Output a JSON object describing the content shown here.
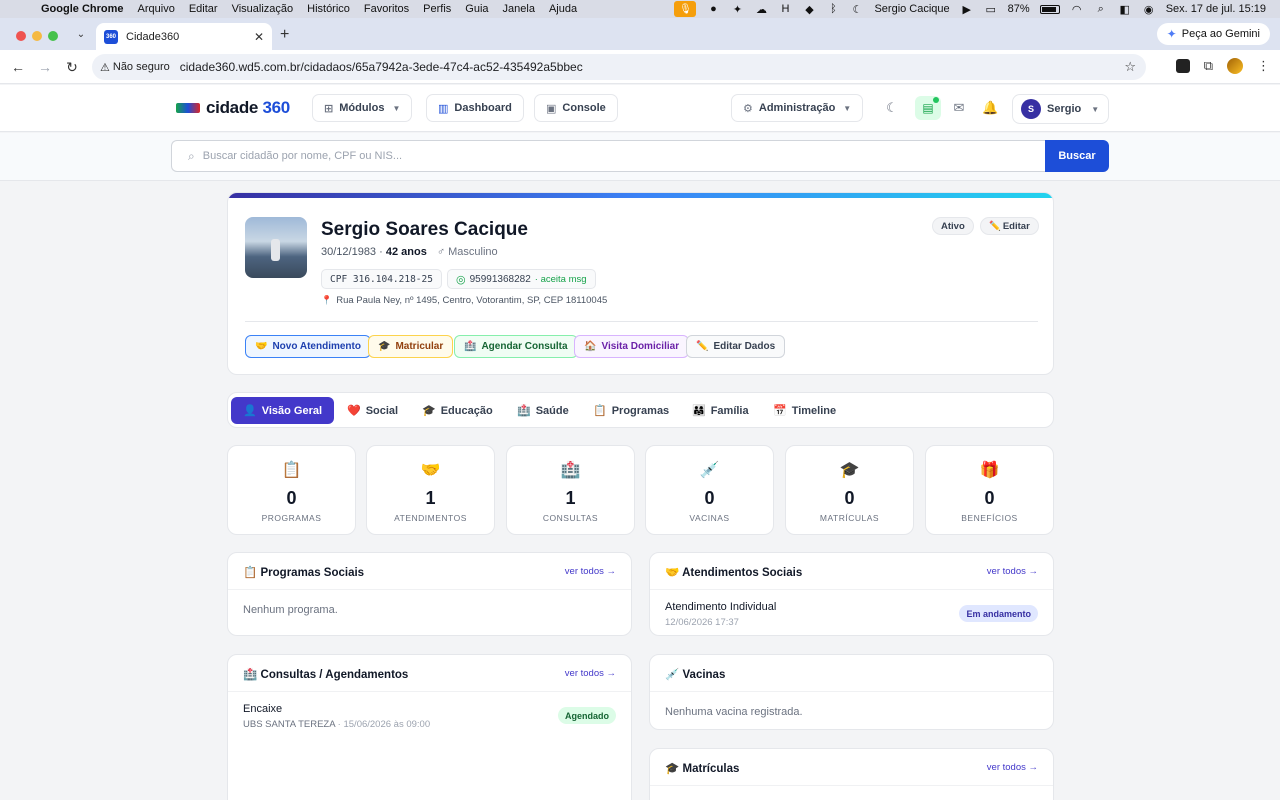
{
  "mac_menubar": {
    "app": "Google Chrome",
    "menus": [
      "Arquivo",
      "Editar",
      "Visualização",
      "Histórico",
      "Favoritos",
      "Perfis",
      "Guia",
      "Janela",
      "Ajuda"
    ],
    "user": "Sergio Cacique",
    "battery": "87%",
    "datetime": "Sex. 17 de jul.  15:19"
  },
  "browser": {
    "tab_title": "Cidade360",
    "favicon_text": "360",
    "gemini_label": "Peça ao Gemini",
    "security_label": "Não seguro",
    "url": "cidade360.wd5.com.br/cidadaos/65a7942a-3ede-47c4-ac52-435492a5bbec"
  },
  "header": {
    "logo_text": "cidade ",
    "logo_number": "360",
    "modulos": "Módulos",
    "dashboard": "Dashboard",
    "console": "Console",
    "administracao": "Administração",
    "user_name": "Sergio",
    "user_initial": "S"
  },
  "search": {
    "placeholder": "Buscar cidadão por nome, CPF ou NIS...",
    "button": "Buscar"
  },
  "profile": {
    "name": "Sergio Soares Cacique",
    "birth": "30/12/1983 · ",
    "age": "42 anos",
    "gender": "♂ Masculino",
    "cpf": "CPF 316.104.218-25",
    "phone": "95991368282",
    "phone_note": "· aceita msg",
    "address": "Rua Paula Ney, nº 1495, Centro, Votorantim, SP, CEP 18110045",
    "status": "Ativo",
    "edit": "Editar",
    "actions": [
      {
        "icon": "🤝",
        "label": "Novo Atendimento"
      },
      {
        "icon": "🎓",
        "label": "Matricular"
      },
      {
        "icon": "🏥",
        "label": "Agendar Consulta"
      },
      {
        "icon": "🏠",
        "label": "Visita Domiciliar"
      },
      {
        "icon": "✏️",
        "label": "Editar Dados"
      }
    ]
  },
  "tabs": [
    {
      "icon": "👤",
      "label": "Visão Geral"
    },
    {
      "icon": "❤️",
      "label": "Social"
    },
    {
      "icon": "🎓",
      "label": "Educação"
    },
    {
      "icon": "🏥",
      "label": "Saúde"
    },
    {
      "icon": "📋",
      "label": "Programas"
    },
    {
      "icon": "👨‍👩‍👧",
      "label": "Família"
    },
    {
      "icon": "📅",
      "label": "Timeline"
    }
  ],
  "stats": [
    {
      "icon": "📋",
      "value": "0",
      "label": "PROGRAMAS"
    },
    {
      "icon": "🤝",
      "value": "1",
      "label": "ATENDIMENTOS"
    },
    {
      "icon": "🏥",
      "value": "1",
      "label": "CONSULTAS"
    },
    {
      "icon": "💉",
      "value": "0",
      "label": "VACINAS"
    },
    {
      "icon": "🎓",
      "value": "0",
      "label": "MATRÍCULAS"
    },
    {
      "icon": "🎁",
      "value": "0",
      "label": "BENEFÍCIOS"
    }
  ],
  "sections": {
    "programas": {
      "title": "📋 Programas Sociais",
      "link": "ver todos →",
      "empty": "Nenhum programa."
    },
    "atendimentos": {
      "title": "🤝 Atendimentos Sociais",
      "link": "ver todos →",
      "item_title": "Atendimento Individual",
      "item_date": "12/06/2026 17:37",
      "badge": "Em andamento"
    },
    "consultas": {
      "title": "🏥 Consultas / Agendamentos",
      "link": "ver todos →",
      "item_title": "Encaixe",
      "item_place": "UBS SANTA TEREZA",
      "item_date": " · 15/06/2026 às 09:00",
      "badge": "Agendado"
    },
    "vacinas": {
      "title": "💉 Vacinas",
      "empty": "Nenhuma vacina registrada."
    },
    "matriculas": {
      "title": "🎓 Matrículas",
      "link": "ver todos →"
    }
  },
  "colors": {
    "primary": "#1d4ed8",
    "accent": "#4338ca",
    "success": "#16a34a"
  }
}
